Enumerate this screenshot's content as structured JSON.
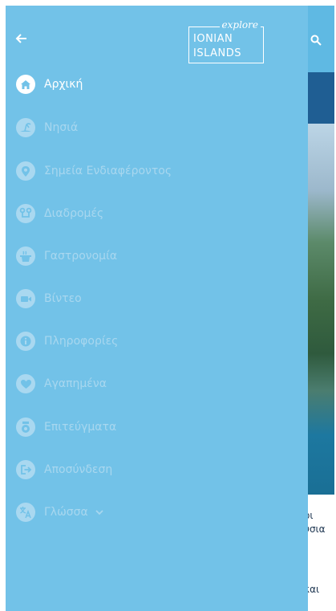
{
  "drawer": {
    "logo": {
      "top_word": "explore",
      "line1": "IONIAN",
      "line2": "ISLANDS"
    },
    "menu": [
      {
        "label": "Αρχική",
        "icon": "home-icon",
        "active": true
      },
      {
        "label": "Νησιά",
        "icon": "island-icon",
        "active": false
      },
      {
        "label": "Σημεία Ενδιαφέροντος",
        "icon": "map-pin-icon",
        "active": false
      },
      {
        "label": "Διαδρομές",
        "icon": "route-icon",
        "active": false
      },
      {
        "label": "Γαστρονομία",
        "icon": "food-icon",
        "active": false
      },
      {
        "label": "Βίντεο",
        "icon": "video-icon",
        "active": false
      },
      {
        "label": "Πληροφορίες",
        "icon": "info-icon",
        "active": false
      },
      {
        "label": "Αγαπημένα",
        "icon": "heart-icon",
        "active": false
      },
      {
        "label": "Επιτεύγματα",
        "icon": "medal-icon",
        "active": false
      },
      {
        "label": "Αποσύνδεση",
        "icon": "logout-icon",
        "active": false
      },
      {
        "label": "Γλώσσα",
        "icon": "translate-icon",
        "active": false
      }
    ]
  },
  "background": {
    "text_lines": [
      "οι",
      "ύσια",
      "και"
    ]
  },
  "colors": {
    "drawer_bg": "#72c2e8",
    "inactive": "#a8d7ef",
    "active": "#ffffff",
    "topbar": "#5fb9e3"
  }
}
